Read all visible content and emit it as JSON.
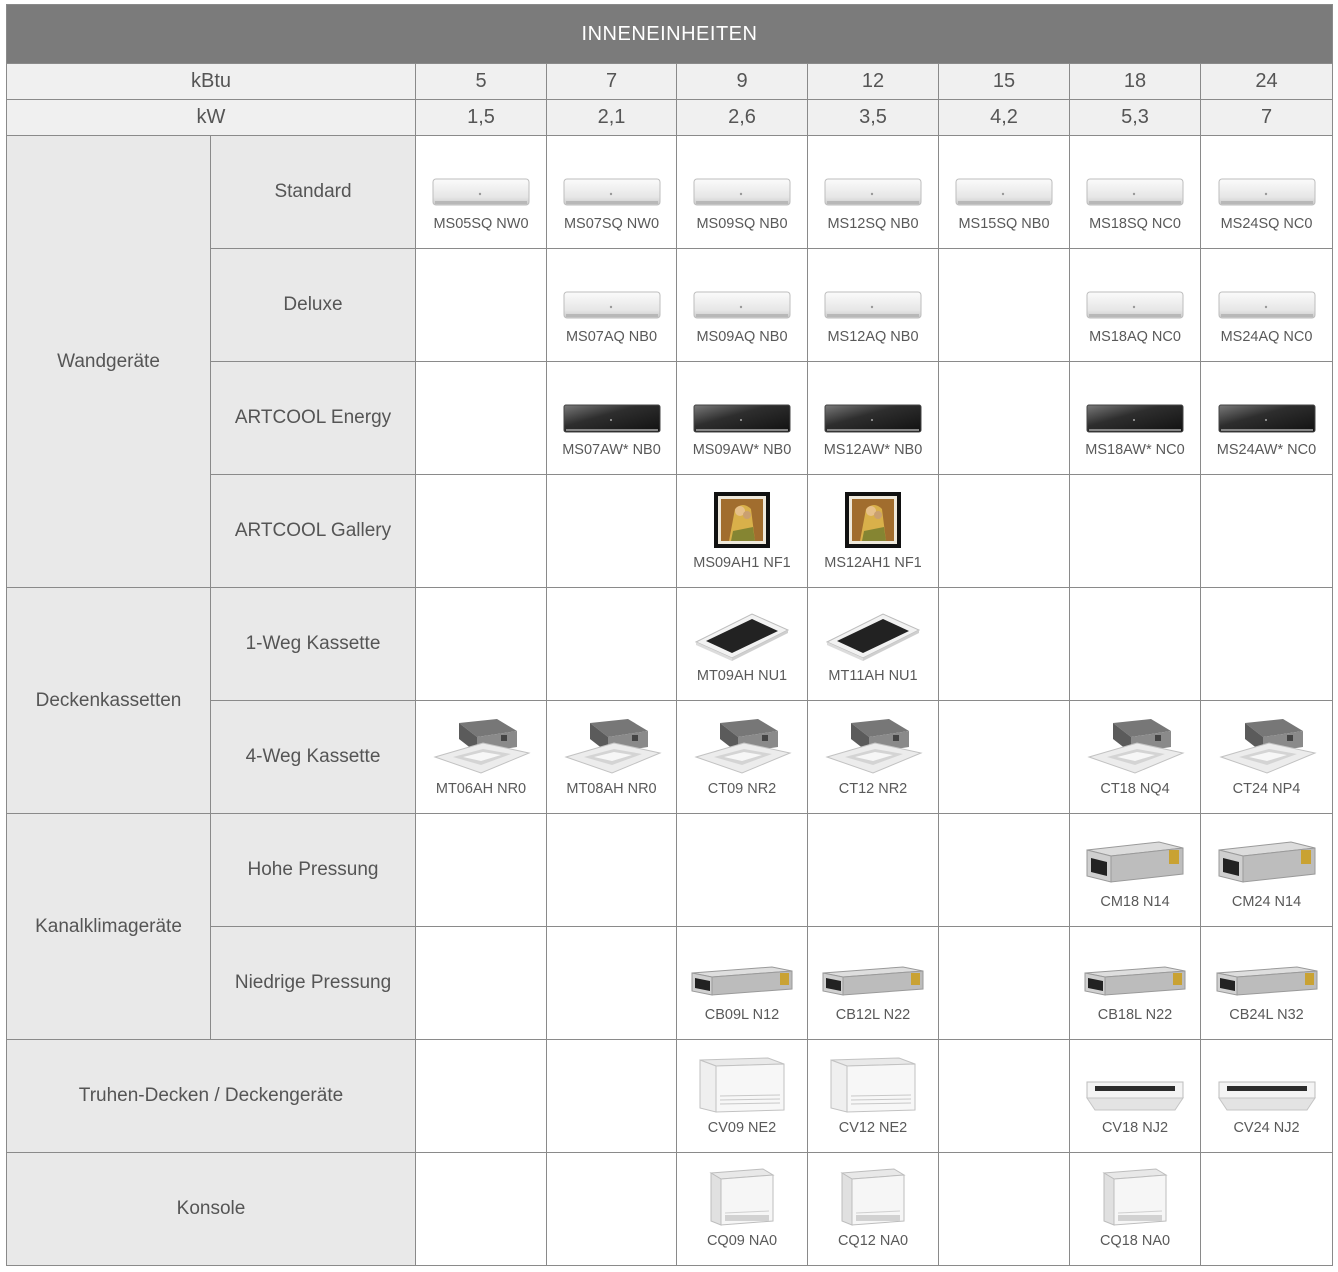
{
  "title": "INNENEINHEITEN",
  "kbtu_label": "kBtu",
  "kw_label": "kW",
  "kbtu": [
    "5",
    "7",
    "9",
    "12",
    "15",
    "18",
    "24"
  ],
  "kw": [
    "1,5",
    "2,1",
    "2,6",
    "3,5",
    "4,2",
    "5,3",
    "7"
  ],
  "groups": {
    "wand": "Wandgeräte",
    "decke": "Deckenkassetten",
    "kanal": "Kanalklimageräte",
    "truhe": "Truhen-Decken / Deckengeräte",
    "konsole": "Konsole"
  },
  "rows": [
    {
      "sub": "Standard",
      "icon": "wall-unit-white-icon",
      "models": [
        "MS05SQ NW0",
        "MS07SQ NW0",
        "MS09SQ NB0",
        "MS12SQ NB0",
        "MS15SQ NB0",
        "MS18SQ NC0",
        "MS24SQ NC0"
      ]
    },
    {
      "sub": "Deluxe",
      "icon": "wall-unit-white-icon",
      "models": [
        "",
        "MS07AQ NB0",
        "MS09AQ NB0",
        "MS12AQ NB0",
        "",
        "MS18AQ NC0",
        "MS24AQ NC0"
      ]
    },
    {
      "sub": "ARTCOOL Energy",
      "icon": "wall-unit-dark-icon",
      "models": [
        "",
        "MS07AW* NB0",
        "MS09AW* NB0",
        "MS12AW* NB0",
        "",
        "MS18AW* NC0",
        "MS24AW* NC0"
      ]
    },
    {
      "sub": "ARTCOOL Gallery",
      "icon": "framed-painting-unit-icon",
      "models": [
        "",
        "",
        "MS09AH1 NF1",
        "MS12AH1 NF1",
        "",
        "",
        ""
      ]
    },
    {
      "sub": "1-Weg Kassette",
      "icon": "one-way-cassette-icon",
      "models": [
        "",
        "",
        "MT09AH NU1",
        "MT11AH NU1",
        "",
        "",
        ""
      ]
    },
    {
      "sub": "4-Weg Kassette",
      "icon": "four-way-cassette-icon",
      "models": [
        "MT06AH NR0",
        "MT08AH NR0",
        "CT09 NR2",
        "CT12 NR2",
        "",
        "CT18 NQ4",
        "CT24 NP4"
      ]
    },
    {
      "sub": "Hohe Pressung",
      "icon": "duct-unit-icon",
      "models": [
        "",
        "",
        "",
        "",
        "",
        "CM18 N14",
        "CM24 N14"
      ]
    },
    {
      "sub": "Niedrige Pressung",
      "icon": "low-duct-unit-icon",
      "models": [
        "",
        "",
        "CB09L N12",
        "CB12L N22",
        "",
        "CB18L N22",
        "CB24L N32"
      ]
    },
    {
      "sub": "",
      "icon": "floor-ceiling-unit-icon",
      "models": [
        "",
        "",
        "CV09 NE2",
        "CV12 NE2",
        "",
        "CV18 NJ2",
        "CV24 NJ2"
      ]
    },
    {
      "sub": "",
      "icon": "console-unit-icon",
      "models": [
        "",
        "",
        "CQ09 NA0",
        "CQ12 NA0",
        "",
        "CQ18 NA0",
        ""
      ]
    }
  ]
}
